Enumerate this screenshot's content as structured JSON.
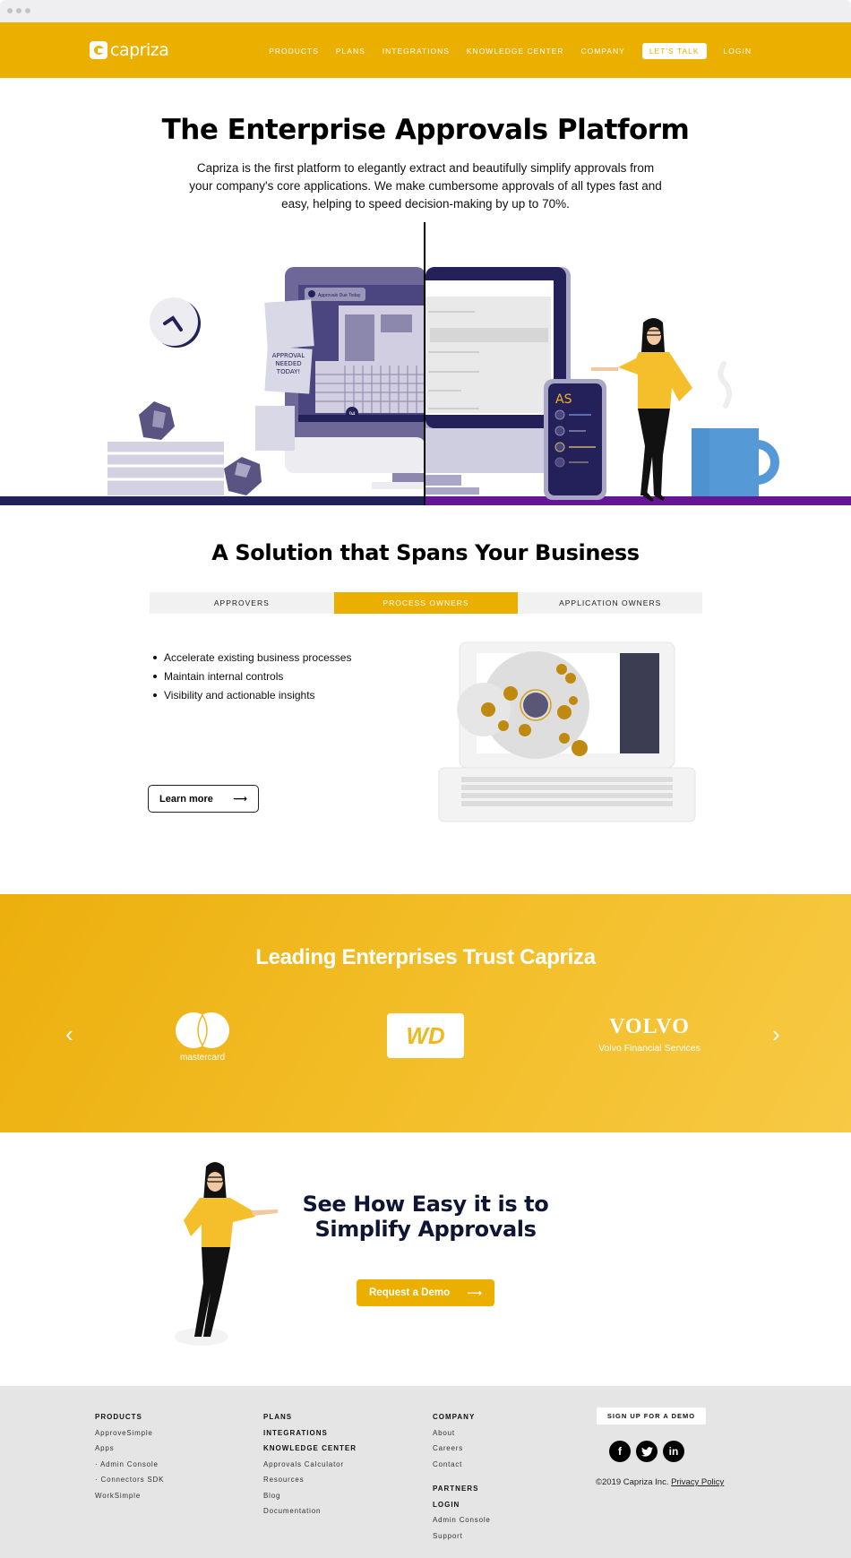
{
  "colors": {
    "brand": "#ebaf00",
    "navy": "#24215a",
    "purple": "#651696",
    "footer_bg": "#e5e5e5"
  },
  "header": {
    "logo_text": "capriza",
    "nav": [
      "PRODUCTS",
      "PLANS",
      "INTEGRATIONS",
      "KNOWLEDGE CENTER",
      "COMPANY"
    ],
    "cta": "LET'S TALK",
    "login": "LOGIN"
  },
  "hero": {
    "title": "The Enterprise Approvals Platform",
    "subtitle": "Capriza is the first platform to elegantly extract and beautifully simplify approvals from your company's core applications. We make cumbersome approvals of all types fast and easy, helping to speed decision-making by up to 70%.",
    "illustration": {
      "window_tab": "Approvals Due Today",
      "sticky_note": "APPROVAL NEEDED TODAY!",
      "badge_count": "94",
      "app_icon": "AS"
    }
  },
  "solution": {
    "title": "A Solution that Spans Your Business",
    "tabs": [
      {
        "label": "APPROVERS",
        "active": false
      },
      {
        "label": "PROCESS OWNERS",
        "active": true
      },
      {
        "label": "APPLICATION OWNERS",
        "active": false
      }
    ],
    "bullets": [
      "Accelerate existing business processes",
      "Maintain internal controls",
      "Visibility and actionable insights"
    ],
    "learn_more": "Learn more",
    "arrow": "⟶"
  },
  "trust": {
    "title": "Leading Enterprises Trust Capriza",
    "prev": "‹",
    "next": "›",
    "logos": [
      {
        "name": "mastercard",
        "text": "mastercard"
      },
      {
        "name": "wd",
        "text": "WD"
      },
      {
        "name": "volvo",
        "text": "VOLVO",
        "sub": "Volvo Financial Services"
      }
    ]
  },
  "cta": {
    "title_line1": "See How Easy it is to",
    "title_line2": "Simplify Approvals",
    "button": "Request a Demo",
    "arrow": "⟶"
  },
  "footer": {
    "col1": {
      "heading": "PRODUCTS",
      "links": [
        "ApproveSimple",
        "Apps",
        "· Admin Console",
        "· Connectors SDK",
        "WorkSimple"
      ]
    },
    "col2": {
      "headings": [
        "PLANS",
        "INTEGRATIONS",
        "KNOWLEDGE CENTER"
      ],
      "links": [
        "Approvals Calculator",
        "Resources",
        "Blog",
        "Documentation"
      ]
    },
    "col3": {
      "heading": "COMPANY",
      "links": [
        "About",
        "Careers",
        "Contact"
      ],
      "headings2": [
        "PARTNERS",
        "LOGIN"
      ],
      "links2": [
        "Admin Console",
        "Support"
      ]
    },
    "signup": "SIGN UP FOR A DEMO",
    "social": [
      {
        "name": "facebook",
        "glyph": "f"
      },
      {
        "name": "twitter",
        "glyph": "t"
      },
      {
        "name": "linkedin",
        "glyph": "in"
      }
    ],
    "copyright": "©2019 Capriza Inc.",
    "privacy": "Privacy Policy"
  }
}
